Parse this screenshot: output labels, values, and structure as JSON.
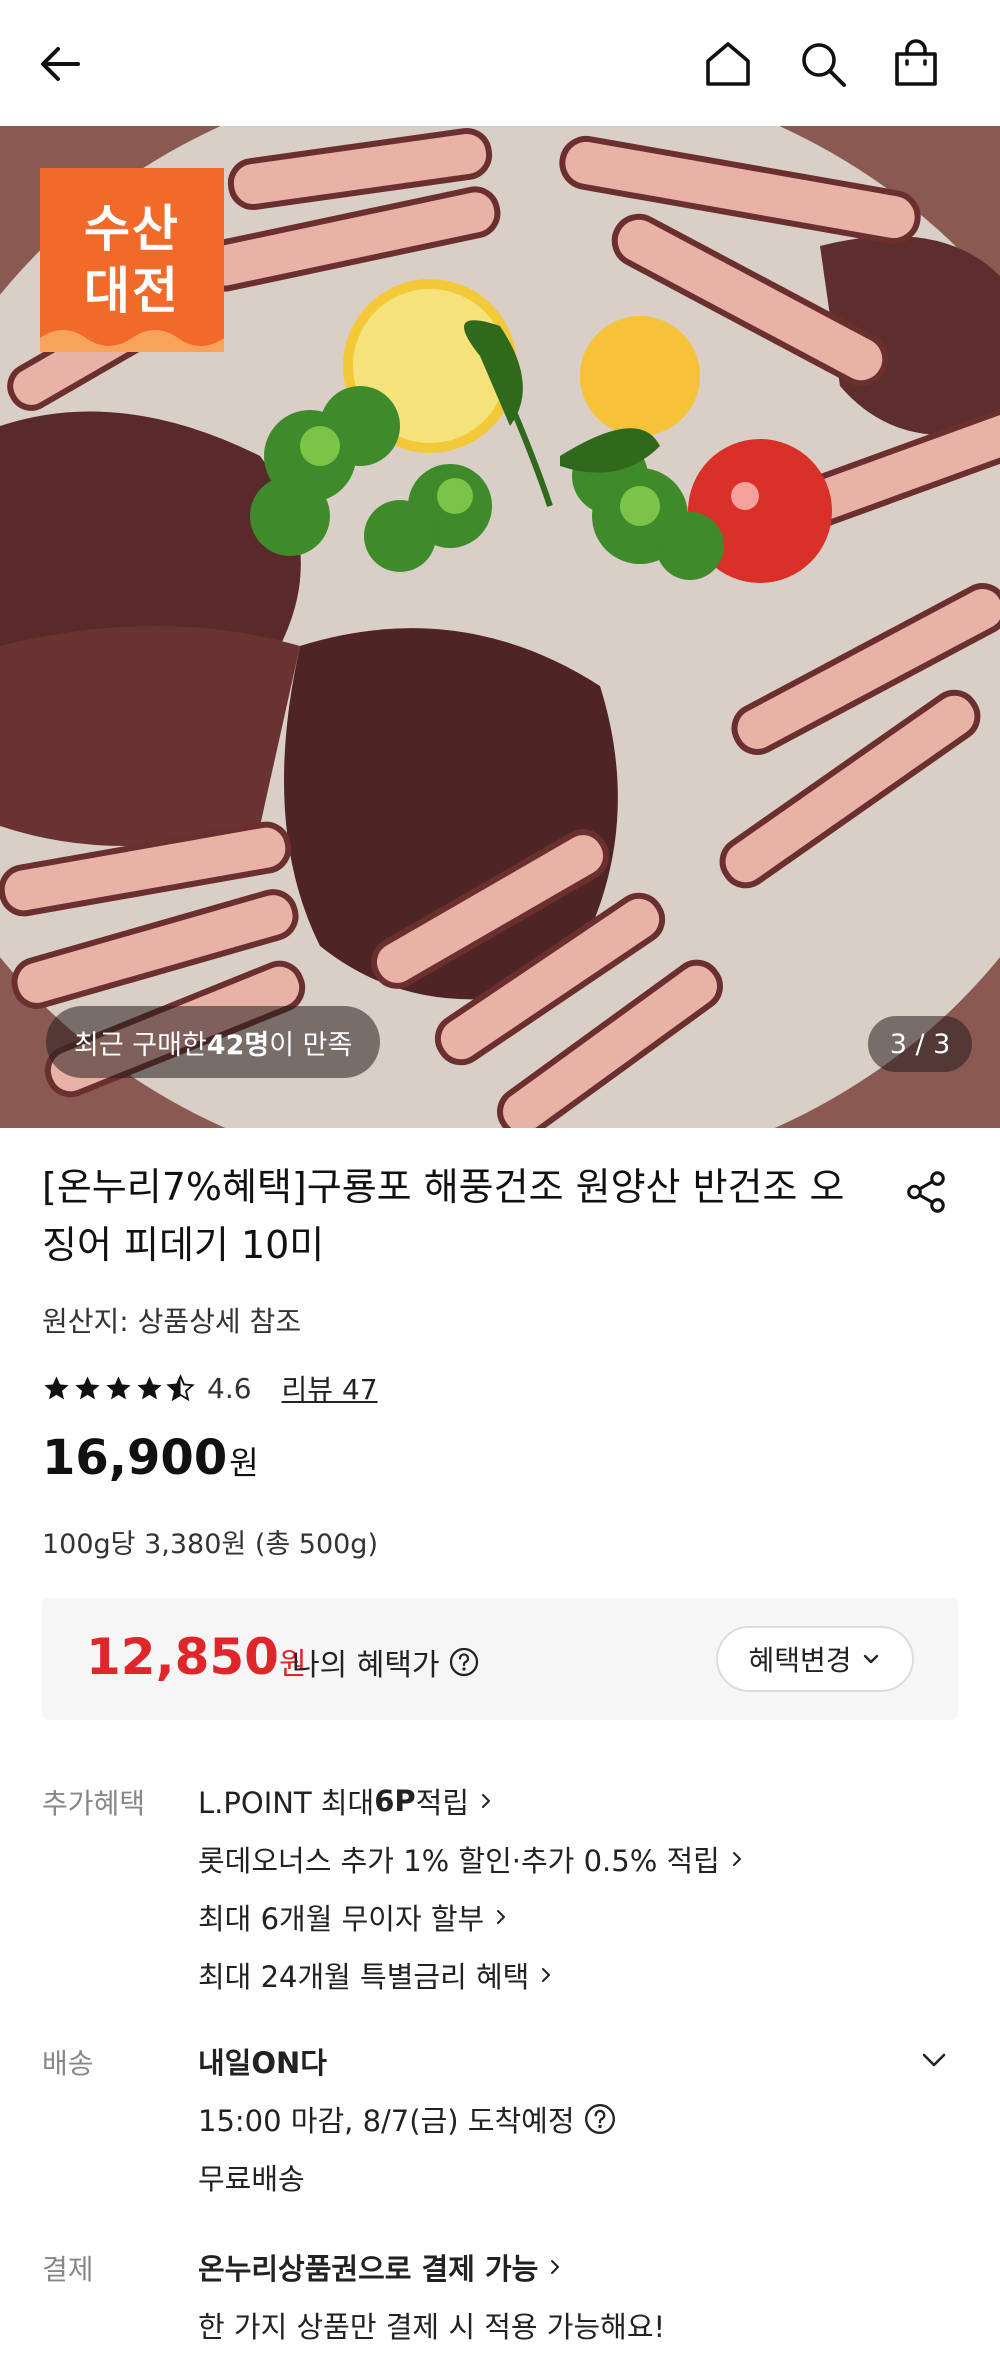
{
  "header": {
    "icons": [
      "back-arrow-icon",
      "home-icon",
      "search-icon",
      "shopping-bag-icon"
    ]
  },
  "hero": {
    "badge_line1": "수산",
    "badge_line2": "대전",
    "buyers_prefix": "최근 구매한 ",
    "buyers_count": "42명",
    "buyers_suffix": "이 만족",
    "image_counter": "3 / 3"
  },
  "product": {
    "title": "[온누리7%혜택]구룡포 해풍건조 원양산 반건조 오징어 피데기 10미",
    "origin": "원산지: 상품상세 참조",
    "rating": "4.6",
    "rating_stars": 4.6,
    "review_link": "리뷰 47",
    "price": "16,900",
    "price_unit": "원",
    "unit_price": "100g당 3,380원 (총 500g)"
  },
  "benefit": {
    "price": "12,850",
    "price_unit": "원",
    "label": "나의 혜택가",
    "change_button": "혜택변경"
  },
  "extra_benefits": {
    "label": "추가혜택",
    "items": [
      {
        "pre": "L.POINT 최대 ",
        "bold": "6P",
        "post": " 적립"
      },
      {
        "pre": "롯데오너스 추가 1% 할인·추가 0.5% 적립",
        "bold": "",
        "post": ""
      },
      {
        "pre": "최대 6개월 무이자 할부",
        "bold": "",
        "post": ""
      },
      {
        "pre": "최대 24개월 특별금리 혜택",
        "bold": "",
        "post": ""
      }
    ]
  },
  "shipping": {
    "label": "배송",
    "title": "내일ON다",
    "eta": "15:00 마감, 8/7(금) 도착예정",
    "fee": "무료배송"
  },
  "payment": {
    "label": "결제",
    "title": "온누리상품권으로 결제 가능",
    "note": "한 가지 상품만 결제 시 적용 가능해요!"
  },
  "colors": {
    "accent_red": "#e0262b",
    "badge_orange": "#f26a2a"
  }
}
